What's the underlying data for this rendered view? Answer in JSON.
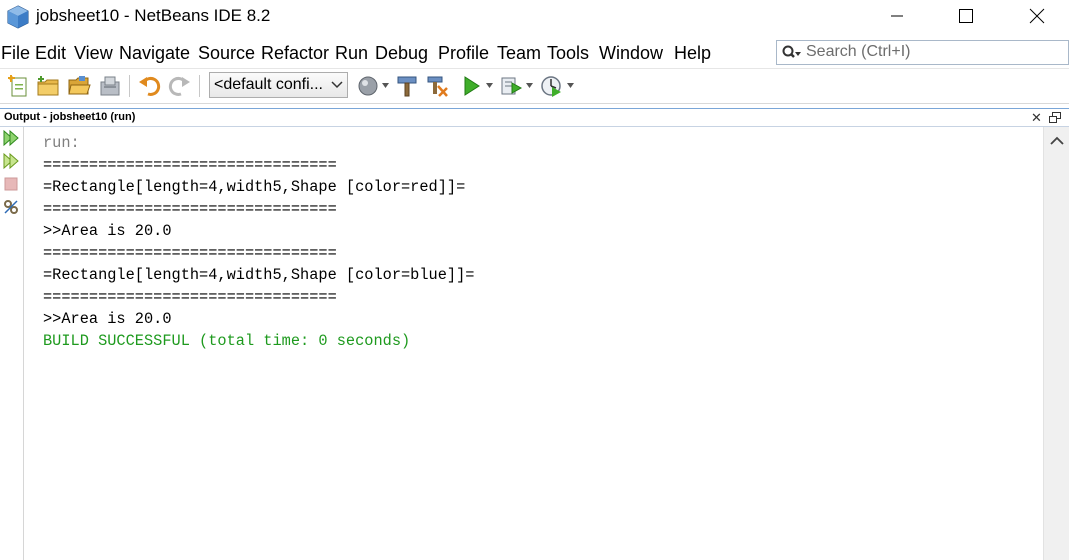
{
  "window": {
    "title": "jobsheet10 - NetBeans IDE 8.2",
    "app_icon": "netbeans-cube-icon",
    "controls": [
      "minimize-icon",
      "maximize-icon",
      "close-icon"
    ]
  },
  "menubar": {
    "items": [
      "File",
      "Edit",
      "View",
      "Navigate",
      "Source",
      "Refactor",
      "Run",
      "Debug",
      "Profile",
      "Team",
      "Tools",
      "Window",
      "Help"
    ]
  },
  "search": {
    "placeholder": "Search (Ctrl+I)",
    "icon": "search-icon"
  },
  "toolbar": {
    "icons": [
      "new-file-icon",
      "new-project-icon",
      "open-project-icon",
      "close-project-icon",
      "undo-icon",
      "redo-icon",
      "browser-icon",
      "build-icon",
      "clean-build-icon",
      "run-icon",
      "debug-icon",
      "profile-icon"
    ],
    "config_value": "<default confi..."
  },
  "output_panel": {
    "title": "Output - jobsheet10 (run)",
    "gutter_icons": [
      "rerun-icon",
      "rerun-with-options-icon",
      "stop-icon",
      "settings-icon"
    ],
    "lines": [
      {
        "text": "run:",
        "style": "run"
      },
      {
        "text": "================================",
        "style": "normal"
      },
      {
        "text": "=Rectangle[length=4,width5,Shape [color=red]]=",
        "style": "normal"
      },
      {
        "text": "================================",
        "style": "normal"
      },
      {
        "text": ">>Area is 20.0",
        "style": "normal"
      },
      {
        "text": "================================",
        "style": "normal"
      },
      {
        "text": "=Rectangle[length=4,width5,Shape [color=blue]]=",
        "style": "normal"
      },
      {
        "text": "================================",
        "style": "normal"
      },
      {
        "text": ">>Area is 20.0",
        "style": "normal"
      },
      {
        "text": "BUILD SUCCESSFUL (total time: 0 seconds)",
        "style": "success"
      }
    ]
  },
  "colors": {
    "success_text": "#1e9a1e",
    "run_text": "#7f7f7f",
    "panel_border": "#7aa6d8"
  }
}
